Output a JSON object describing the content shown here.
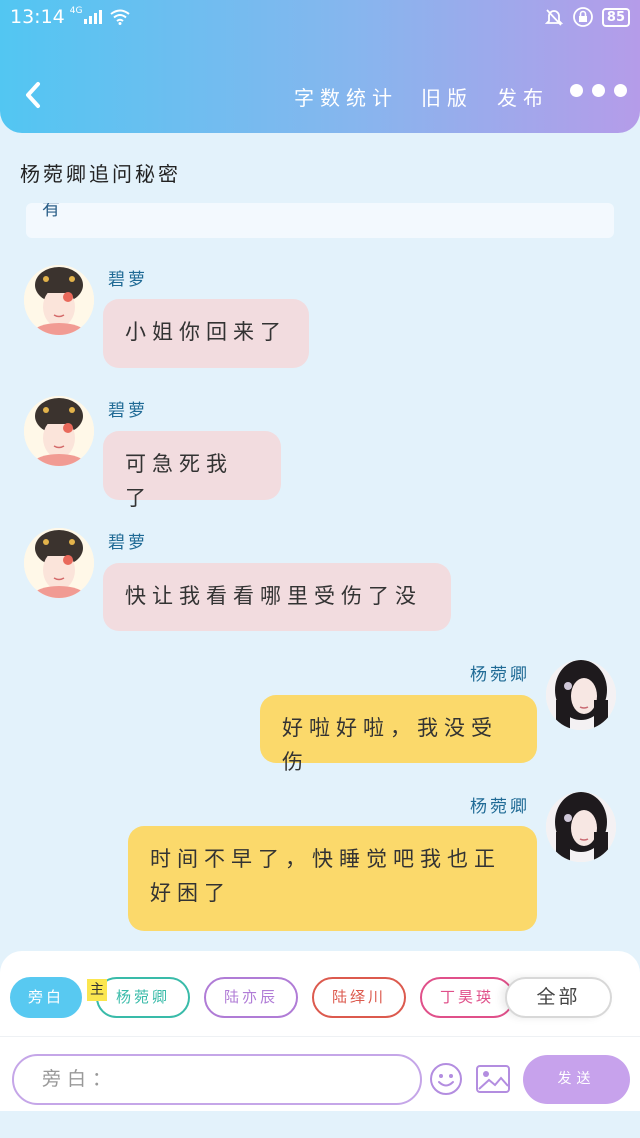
{
  "status_bar": {
    "time": "13:14",
    "network": "4G",
    "battery": "85"
  },
  "nav": {
    "actions": [
      "字数统计",
      "旧版",
      "发布"
    ]
  },
  "chat": {
    "title": "杨菀卿追问秘密",
    "prev_fragment": "有",
    "messages": [
      {
        "speaker": "碧萝",
        "side": "left",
        "text": "小姐你回来了"
      },
      {
        "speaker": "碧萝",
        "side": "left",
        "text": "可急死我了"
      },
      {
        "speaker": "碧萝",
        "side": "left",
        "text": "快让我看看哪里受伤了没"
      },
      {
        "speaker": "杨菀卿",
        "side": "right",
        "text": "好啦好啦，我没受伤"
      },
      {
        "speaker": "杨菀卿",
        "side": "right",
        "text": "时间不早了，快睡觉吧我也正好困了"
      }
    ]
  },
  "composer": {
    "main_badge": "主",
    "roles": [
      {
        "label": "旁白",
        "active": true,
        "color": "#58c9f1"
      },
      {
        "label": "杨菀卿",
        "active": false,
        "color": "#39bba9"
      },
      {
        "label": "陆亦辰",
        "active": false,
        "color": "#b07cd6"
      },
      {
        "label": "陆绎川",
        "active": false,
        "color": "#dc5a4e"
      },
      {
        "label": "丁昊瑛",
        "active": false,
        "color": "#e0508a"
      }
    ],
    "all_label": "全部",
    "input_placeholder": "旁白：",
    "send_label": "发送"
  },
  "colors": {
    "header_start": "#52c6f2",
    "header_end": "#b59ce9",
    "left_bubble": "#f2dcdf",
    "right_bubble": "#fbd96b",
    "accent_purple": "#c7a2ec"
  }
}
